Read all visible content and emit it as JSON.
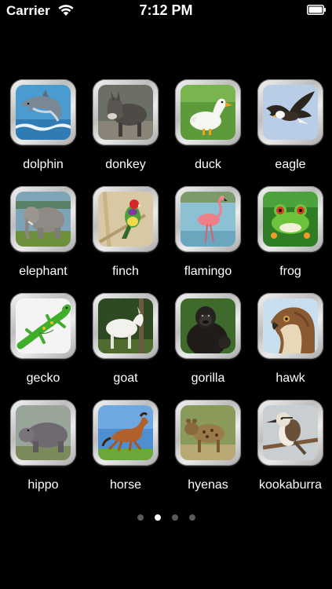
{
  "status_bar": {
    "carrier": "Carrier",
    "time": "7:12 PM"
  },
  "apps": [
    {
      "label": "dolphin",
      "icon": "dolphin-icon"
    },
    {
      "label": "donkey",
      "icon": "donkey-icon"
    },
    {
      "label": "duck",
      "icon": "duck-icon"
    },
    {
      "label": "eagle",
      "icon": "eagle-icon"
    },
    {
      "label": "elephant",
      "icon": "elephant-icon"
    },
    {
      "label": "finch",
      "icon": "finch-icon"
    },
    {
      "label": "flamingo",
      "icon": "flamingo-icon"
    },
    {
      "label": "frog",
      "icon": "frog-icon"
    },
    {
      "label": "gecko",
      "icon": "gecko-icon"
    },
    {
      "label": "goat",
      "icon": "goat-icon"
    },
    {
      "label": "gorilla",
      "icon": "gorilla-icon"
    },
    {
      "label": "hawk",
      "icon": "hawk-icon"
    },
    {
      "label": "hippo",
      "icon": "hippo-icon"
    },
    {
      "label": "horse",
      "icon": "horse-icon"
    },
    {
      "label": "hyenas",
      "icon": "hyenas-icon"
    },
    {
      "label": "kookaburra",
      "icon": "kookaburra-icon"
    }
  ],
  "page_indicator": {
    "count": 4,
    "current": 2
  }
}
